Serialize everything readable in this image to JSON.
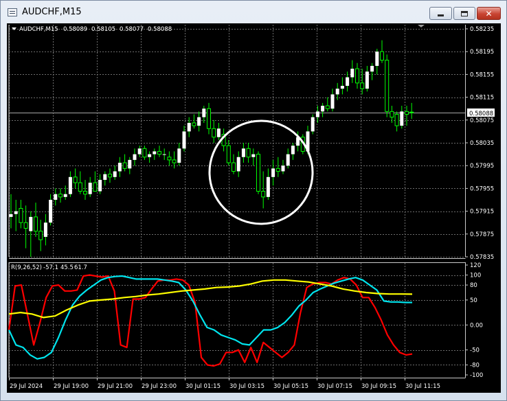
{
  "window": {
    "title": "AUDCHF,M15"
  },
  "chart": {
    "symbol_label": "AUDCHF,M15",
    "ohlc": [
      "0.58089",
      "0.58105",
      "0.58077",
      "0.58088"
    ],
    "current_price": "0.58088",
    "price_axis": [
      "0.58235",
      "0.58195",
      "0.58155",
      "0.58115",
      "0.58075",
      "0.58035",
      "0.57995",
      "0.57955",
      "0.57915",
      "0.57875",
      "0.57835"
    ],
    "time_axis": [
      "29 Jul 2024",
      "29 Jul 19:00",
      "29 Jul 21:00",
      "29 Jul 23:00",
      "30 Jul 01:15",
      "30 Jul 03:15",
      "30 Jul 05:15",
      "30 Jul 07:15",
      "30 Jul 09:15",
      "30 Jul 11:15"
    ]
  },
  "indicator": {
    "label": "R(9,26,52)",
    "values": [
      "-57.1",
      "45.5",
      "61.7"
    ],
    "axis": [
      "120",
      "100",
      "80",
      "50",
      "0.00",
      "-50",
      "-80",
      "-100"
    ]
  },
  "colors": {
    "background": "#000000",
    "grid": "#6e6e6e",
    "bull_candle": "#ffffff",
    "bear_candle": "#000000",
    "wick": "#00ff00",
    "line_fast": "#ff0000",
    "line_mid": "#00e5ee",
    "line_slow": "#ffff00",
    "highlight_circle": "#ffffff"
  },
  "chart_data": {
    "type": "candlestick",
    "price_ylim": [
      0.57835,
      0.58235
    ],
    "indicator_ylim": [
      -100,
      120
    ],
    "grid": true,
    "candles": [
      {
        "o": 0.57905,
        "h": 0.57945,
        "l": 0.57885,
        "c": 0.5791
      },
      {
        "o": 0.5791,
        "h": 0.57935,
        "l": 0.5788,
        "c": 0.57915
      },
      {
        "o": 0.5792,
        "h": 0.57935,
        "l": 0.57885,
        "c": 0.57895
      },
      {
        "o": 0.57895,
        "h": 0.57925,
        "l": 0.5785,
        "c": 0.57885
      },
      {
        "o": 0.5788,
        "h": 0.57915,
        "l": 0.57835,
        "c": 0.57905
      },
      {
        "o": 0.57905,
        "h": 0.5793,
        "l": 0.5787,
        "c": 0.5788
      },
      {
        "o": 0.5788,
        "h": 0.579,
        "l": 0.57845,
        "c": 0.57865
      },
      {
        "o": 0.5787,
        "h": 0.5791,
        "l": 0.57855,
        "c": 0.57895
      },
      {
        "o": 0.57895,
        "h": 0.57945,
        "l": 0.5789,
        "c": 0.57935
      },
      {
        "o": 0.57935,
        "h": 0.57955,
        "l": 0.57925,
        "c": 0.57945
      },
      {
        "o": 0.57945,
        "h": 0.57955,
        "l": 0.5793,
        "c": 0.5794
      },
      {
        "o": 0.5794,
        "h": 0.5796,
        "l": 0.57935,
        "c": 0.57945
      },
      {
        "o": 0.57945,
        "h": 0.57985,
        "l": 0.5794,
        "c": 0.57975
      },
      {
        "o": 0.57975,
        "h": 0.5799,
        "l": 0.57955,
        "c": 0.57965
      },
      {
        "o": 0.57965,
        "h": 0.57985,
        "l": 0.57945,
        "c": 0.5795
      },
      {
        "o": 0.5795,
        "h": 0.5797,
        "l": 0.57935,
        "c": 0.57945
      },
      {
        "o": 0.57945,
        "h": 0.57975,
        "l": 0.5794,
        "c": 0.57965
      },
      {
        "o": 0.57965,
        "h": 0.57985,
        "l": 0.5795,
        "c": 0.5795
      },
      {
        "o": 0.5795,
        "h": 0.5798,
        "l": 0.57945,
        "c": 0.5797
      },
      {
        "o": 0.5797,
        "h": 0.57985,
        "l": 0.5796,
        "c": 0.5798
      },
      {
        "o": 0.5798,
        "h": 0.5799,
        "l": 0.57965,
        "c": 0.57975
      },
      {
        "o": 0.57975,
        "h": 0.57995,
        "l": 0.5797,
        "c": 0.57985
      },
      {
        "o": 0.57985,
        "h": 0.5801,
        "l": 0.57975,
        "c": 0.58
      },
      {
        "o": 0.58,
        "h": 0.58015,
        "l": 0.57985,
        "c": 0.5799
      },
      {
        "o": 0.5799,
        "h": 0.5801,
        "l": 0.5798,
        "c": 0.58005
      },
      {
        "o": 0.58005,
        "h": 0.58025,
        "l": 0.57995,
        "c": 0.58015
      },
      {
        "o": 0.58015,
        "h": 0.5803,
        "l": 0.5801,
        "c": 0.58025
      },
      {
        "o": 0.58025,
        "h": 0.5803,
        "l": 0.58005,
        "c": 0.5801
      },
      {
        "o": 0.5801,
        "h": 0.5802,
        "l": 0.58,
        "c": 0.58015
      },
      {
        "o": 0.58015,
        "h": 0.58025,
        "l": 0.58005,
        "c": 0.5802
      },
      {
        "o": 0.5802,
        "h": 0.5803,
        "l": 0.5801,
        "c": 0.58015
      },
      {
        "o": 0.58015,
        "h": 0.58025,
        "l": 0.58005,
        "c": 0.58015
      },
      {
        "o": 0.5801,
        "h": 0.5802,
        "l": 0.57995,
        "c": 0.58005
      },
      {
        "o": 0.58005,
        "h": 0.5802,
        "l": 0.5799,
        "c": 0.58
      },
      {
        "o": 0.58,
        "h": 0.58035,
        "l": 0.57995,
        "c": 0.58025
      },
      {
        "o": 0.58025,
        "h": 0.58065,
        "l": 0.5802,
        "c": 0.58055
      },
      {
        "o": 0.58055,
        "h": 0.5808,
        "l": 0.58045,
        "c": 0.5807
      },
      {
        "o": 0.5807,
        "h": 0.58085,
        "l": 0.5806,
        "c": 0.58065
      },
      {
        "o": 0.58065,
        "h": 0.5809,
        "l": 0.58055,
        "c": 0.5808
      },
      {
        "o": 0.5808,
        "h": 0.581,
        "l": 0.5807,
        "c": 0.58095
      },
      {
        "o": 0.58095,
        "h": 0.58105,
        "l": 0.5805,
        "c": 0.5806
      },
      {
        "o": 0.5806,
        "h": 0.58075,
        "l": 0.58035,
        "c": 0.58045
      },
      {
        "o": 0.58045,
        "h": 0.5807,
        "l": 0.5804,
        "c": 0.5806
      },
      {
        "o": 0.5805,
        "h": 0.5806,
        "l": 0.5802,
        "c": 0.5803
      },
      {
        "o": 0.5803,
        "h": 0.5804,
        "l": 0.57995,
        "c": 0.58
      },
      {
        "o": 0.58,
        "h": 0.58015,
        "l": 0.5798,
        "c": 0.57985
      },
      {
        "o": 0.57985,
        "h": 0.5802,
        "l": 0.57975,
        "c": 0.5801
      },
      {
        "o": 0.5801,
        "h": 0.58035,
        "l": 0.58,
        "c": 0.58025
      },
      {
        "o": 0.58025,
        "h": 0.58035,
        "l": 0.58,
        "c": 0.5801
      },
      {
        "o": 0.5801,
        "h": 0.58025,
        "l": 0.57995,
        "c": 0.58015
      },
      {
        "o": 0.58015,
        "h": 0.5802,
        "l": 0.57945,
        "c": 0.5795
      },
      {
        "o": 0.5795,
        "h": 0.57985,
        "l": 0.5792,
        "c": 0.5794
      },
      {
        "o": 0.5794,
        "h": 0.5799,
        "l": 0.57935,
        "c": 0.57975
      },
      {
        "o": 0.57975,
        "h": 0.58005,
        "l": 0.5796,
        "c": 0.5799
      },
      {
        "o": 0.5799,
        "h": 0.5801,
        "l": 0.57975,
        "c": 0.57985
      },
      {
        "o": 0.57985,
        "h": 0.58005,
        "l": 0.5798,
        "c": 0.57995
      },
      {
        "o": 0.57995,
        "h": 0.58025,
        "l": 0.5799,
        "c": 0.58015
      },
      {
        "o": 0.58015,
        "h": 0.58035,
        "l": 0.58005,
        "c": 0.5803
      },
      {
        "o": 0.5803,
        "h": 0.58055,
        "l": 0.5802,
        "c": 0.58045
      },
      {
        "o": 0.58045,
        "h": 0.5805,
        "l": 0.58015,
        "c": 0.5802
      },
      {
        "o": 0.5802,
        "h": 0.58065,
        "l": 0.58015,
        "c": 0.58055
      },
      {
        "o": 0.58055,
        "h": 0.58085,
        "l": 0.5805,
        "c": 0.5808
      },
      {
        "o": 0.5808,
        "h": 0.581,
        "l": 0.5807,
        "c": 0.5809
      },
      {
        "o": 0.5809,
        "h": 0.58105,
        "l": 0.5808,
        "c": 0.581
      },
      {
        "o": 0.581,
        "h": 0.58115,
        "l": 0.5809,
        "c": 0.58095
      },
      {
        "o": 0.58095,
        "h": 0.5813,
        "l": 0.5809,
        "c": 0.5812
      },
      {
        "o": 0.5812,
        "h": 0.5814,
        "l": 0.5811,
        "c": 0.5813
      },
      {
        "o": 0.5813,
        "h": 0.5815,
        "l": 0.5812,
        "c": 0.58135
      },
      {
        "o": 0.58135,
        "h": 0.5816,
        "l": 0.58125,
        "c": 0.5815
      },
      {
        "o": 0.5815,
        "h": 0.5818,
        "l": 0.5814,
        "c": 0.58165
      },
      {
        "o": 0.58165,
        "h": 0.58175,
        "l": 0.5813,
        "c": 0.5814
      },
      {
        "o": 0.5814,
        "h": 0.58165,
        "l": 0.5812,
        "c": 0.5813
      },
      {
        "o": 0.5813,
        "h": 0.5817,
        "l": 0.58125,
        "c": 0.5816
      },
      {
        "o": 0.5816,
        "h": 0.58175,
        "l": 0.58145,
        "c": 0.5817
      },
      {
        "o": 0.5817,
        "h": 0.582,
        "l": 0.58155,
        "c": 0.58195
      },
      {
        "o": 0.58195,
        "h": 0.58215,
        "l": 0.58175,
        "c": 0.5818
      },
      {
        "o": 0.5818,
        "h": 0.5819,
        "l": 0.5808,
        "c": 0.5809
      },
      {
        "o": 0.5809,
        "h": 0.581,
        "l": 0.5807,
        "c": 0.5808
      },
      {
        "o": 0.58085,
        "h": 0.5809,
        "l": 0.58055,
        "c": 0.58065
      },
      {
        "o": 0.58065,
        "h": 0.581,
        "l": 0.5806,
        "c": 0.5809
      },
      {
        "o": 0.5809,
        "h": 0.581,
        "l": 0.58065,
        "c": 0.58085
      },
      {
        "o": 0.58089,
        "h": 0.58105,
        "l": 0.58077,
        "c": 0.58088
      }
    ],
    "series": [
      {
        "color": "#ff0000",
        "values": [
          -10,
          78,
          80,
          20,
          -40,
          5,
          55,
          78,
          80,
          68,
          68,
          70,
          98,
          100,
          98,
          96,
          98,
          68,
          -40,
          -45,
          52,
          52,
          55,
          72,
          88,
          90,
          90,
          92,
          90,
          80,
          45,
          -65,
          -80,
          -82,
          -78,
          -55,
          -55,
          -50,
          -75,
          -45,
          -75,
          -35,
          -45,
          -55,
          -65,
          -55,
          -40,
          25,
          75,
          82,
          85,
          85,
          82,
          90,
          95,
          92,
          80,
          55,
          55,
          35,
          10,
          -20,
          -40,
          -55,
          -60,
          -58
        ]
      },
      {
        "color": "#00e5ee",
        "values": [
          -10,
          -40,
          -45,
          -60,
          -68,
          -65,
          -55,
          -25,
          10,
          40,
          58,
          70,
          80,
          90,
          95,
          97,
          98,
          95,
          92,
          92,
          92,
          92,
          90,
          88,
          85,
          70,
          48,
          20,
          -5,
          -10,
          -20,
          -25,
          -30,
          -38,
          -40,
          -25,
          -10,
          -10,
          -5,
          5,
          20,
          38,
          50,
          65,
          72,
          78,
          84,
          88,
          92,
          95,
          90,
          80,
          70,
          48,
          46,
          46,
          45,
          45
        ]
      },
      {
        "color": "#ffff00",
        "values": [
          22,
          25,
          22,
          15,
          18,
          30,
          40,
          48,
          50,
          52,
          55,
          57,
          60,
          62,
          65,
          68,
          70,
          72,
          75,
          76,
          78,
          82,
          88,
          90,
          90,
          88,
          86,
          82,
          78,
          72,
          68,
          65,
          63,
          62,
          62,
          61.7
        ]
      }
    ]
  }
}
